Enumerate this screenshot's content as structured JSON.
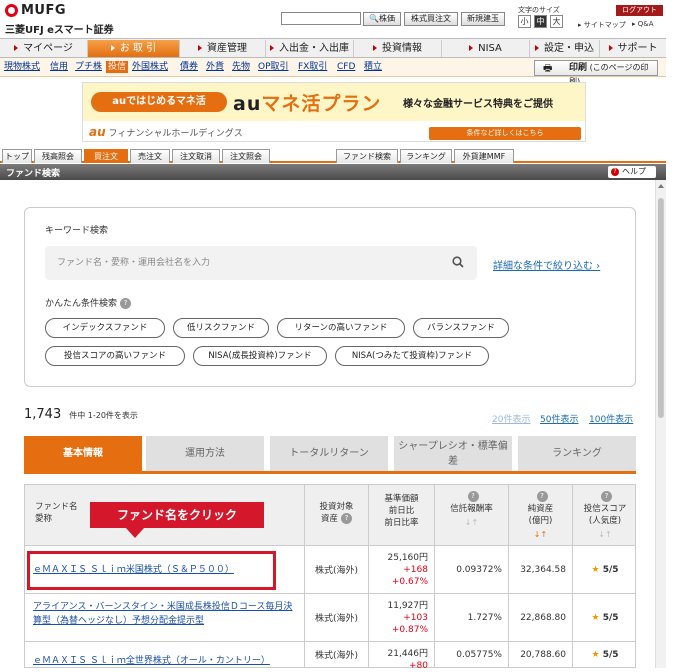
{
  "header": {
    "logo": "MUFG",
    "bank": "三菱UFJ eスマート証券",
    "search_placeholder": "",
    "search_btn": "株価",
    "btn_kabu": "株式買注文",
    "btn_new": "新規建玉",
    "font_size_label": "文字のサイズ",
    "font_sizes": [
      "小",
      "中",
      "大"
    ],
    "logout": "ログアウト",
    "sitemap": "サイトマップ",
    "qa": "Q&A"
  },
  "global_nav": [
    {
      "label": "マイページ"
    },
    {
      "label": "お 取 引"
    },
    {
      "label": "資産管理"
    },
    {
      "label": "入出金・入出庫"
    },
    {
      "label": "投資情報"
    },
    {
      "label": "NISA"
    },
    {
      "label": "設定・申込"
    },
    {
      "label": "サポート"
    }
  ],
  "sub_nav": [
    "現物株式",
    "信用",
    "プチ株",
    "投信",
    "外国株式",
    "債券",
    "外貨",
    "先物",
    "OP取引",
    "FX取引",
    "CFD",
    "積立"
  ],
  "print": {
    "label": "印刷",
    "note": "(このページの印刷)"
  },
  "banner": {
    "pill": "auではじめるマネ活",
    "brand_au": "au",
    "brand_rest": "マネ活プラン",
    "message": "様々な金融サービス特典をご提供",
    "au_logo": "au",
    "au_company": "フィナンシャルホールディングス",
    "button": "条件など詳しくはこちら"
  },
  "sub_tabs": [
    "トップ",
    "残高照会",
    "買注文",
    "売注文",
    "注文取消",
    "注文照会",
    "ファンド検索",
    "ランキング",
    "外貨建MMF"
  ],
  "page_header": {
    "title": "ファンド検索",
    "help": "ヘルプ"
  },
  "search": {
    "keyword_label": "キーワード検索",
    "keyword_placeholder": "ファンド名・愛称・運用会社名を入力",
    "advanced_link": "詳細な条件で絞り込む ›",
    "easy_label": "かんたん条件検索",
    "chips": [
      "インデックスファンド",
      "低リスクファンド",
      "リターンの高いファンド",
      "バランスファンド",
      "投信スコアの高いファンド",
      "NISA(成長投資枠)ファンド",
      "NISA(つみたて投資枠)ファンド"
    ]
  },
  "results": {
    "total": "1,743",
    "range": "件中 1-20件を表示",
    "per_page": [
      "20件表示",
      "50件表示",
      "100件表示"
    ]
  },
  "result_tabs": [
    "基本情報",
    "運用方法",
    "トータルリターン",
    "シャープレシオ・標準偏差",
    "ランキング"
  ],
  "table": {
    "headers": {
      "name": "ファンド名\n愛称",
      "asset": "投資対象\n資産",
      "price": "基準価額\n前日比\n前日比率",
      "fee": "信託報酬率",
      "nav": "純資産\n(億円)",
      "score": "投信スコア\n(人気度)"
    },
    "rows": [
      {
        "name": "ｅＭＡＸＩＳ Ｓｌｉｍ米国株式（Ｓ＆Ｐ５００）",
        "asset": "株式(海外)",
        "price": "25,160円",
        "change": "+168",
        "ratio": "+0.67%",
        "fee": "0.09372%",
        "nav": "32,364.58",
        "score": "5/5"
      },
      {
        "name": "アライアンス・バーンスタイン・米国成長株投信Ｄコース毎月決算型（為替ヘッジなし）予想分配金提示型",
        "asset": "株式(海外)",
        "price": "11,927円",
        "change": "+103",
        "ratio": "+0.87%",
        "fee": "1.727%",
        "nav": "22,868.80",
        "score": "5/5"
      },
      {
        "name": "ｅＭＡＸＩＳ Ｓｌｉｍ全世界株式（オール・カントリー）",
        "asset": "株式(海外)",
        "price": "21,446円",
        "change": "+80",
        "ratio": "",
        "fee": "0.05775%",
        "nav": "20,788.60",
        "score": "5/5"
      }
    ]
  },
  "callout": "ファンド名をクリック"
}
